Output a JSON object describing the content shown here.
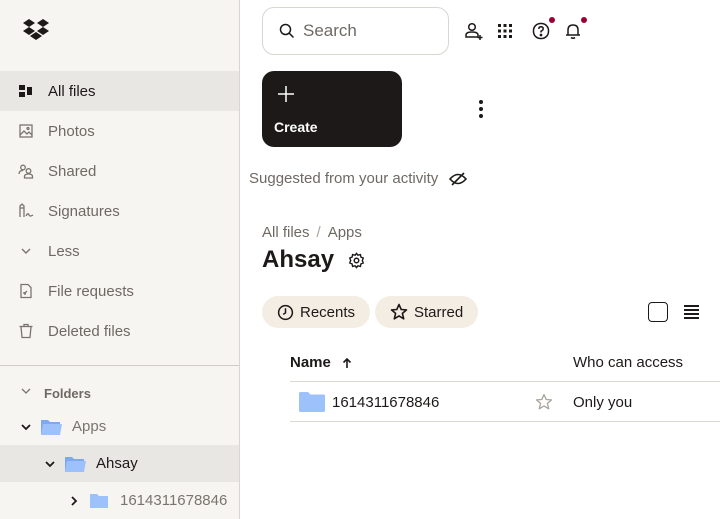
{
  "sidebar": {
    "logo": "dropbox-logo",
    "items": [
      {
        "label": "All files",
        "icon": "all-files-icon",
        "active": true
      },
      {
        "label": "Photos",
        "icon": "photos-icon"
      },
      {
        "label": "Shared",
        "icon": "shared-icon"
      },
      {
        "label": "Signatures",
        "icon": "signatures-icon"
      },
      {
        "label": "Less",
        "icon": "chevron-down-icon"
      },
      {
        "label": "File requests",
        "icon": "file-request-icon"
      },
      {
        "label": "Deleted files",
        "icon": "trash-icon"
      }
    ],
    "folders": {
      "header": "Folders",
      "tree": [
        {
          "label": "Apps",
          "expanded": true,
          "level": 0
        },
        {
          "label": "Ahsay",
          "expanded": true,
          "level": 1,
          "active": true
        },
        {
          "label": "1614311678846",
          "expanded": false,
          "level": 2
        }
      ]
    }
  },
  "topbar": {
    "search_placeholder": "Search",
    "icons": [
      "add-member-icon",
      "apps-grid-icon",
      "help-icon",
      "notifications-icon"
    ],
    "badge_color": "#9b0032"
  },
  "create": {
    "label": "Create"
  },
  "suggested": {
    "label": "Suggested from your activity"
  },
  "breadcrumb": {
    "items": [
      "All files",
      "Apps"
    ],
    "separator": "/"
  },
  "page": {
    "title": "Ahsay"
  },
  "filters": {
    "recents": "Recents",
    "starred": "Starred"
  },
  "table": {
    "columns": {
      "name": "Name",
      "access": "Who can access"
    },
    "sort": "ascending",
    "rows": [
      {
        "name": "1614311678846",
        "type": "folder",
        "starred": false,
        "access": "Only you"
      }
    ]
  },
  "colors": {
    "accent_dark": "#1e1919",
    "sidebar_bg": "#f7f5f2",
    "folder_blue": "#9dc1fb",
    "chip_bg": "#f3ede4"
  }
}
